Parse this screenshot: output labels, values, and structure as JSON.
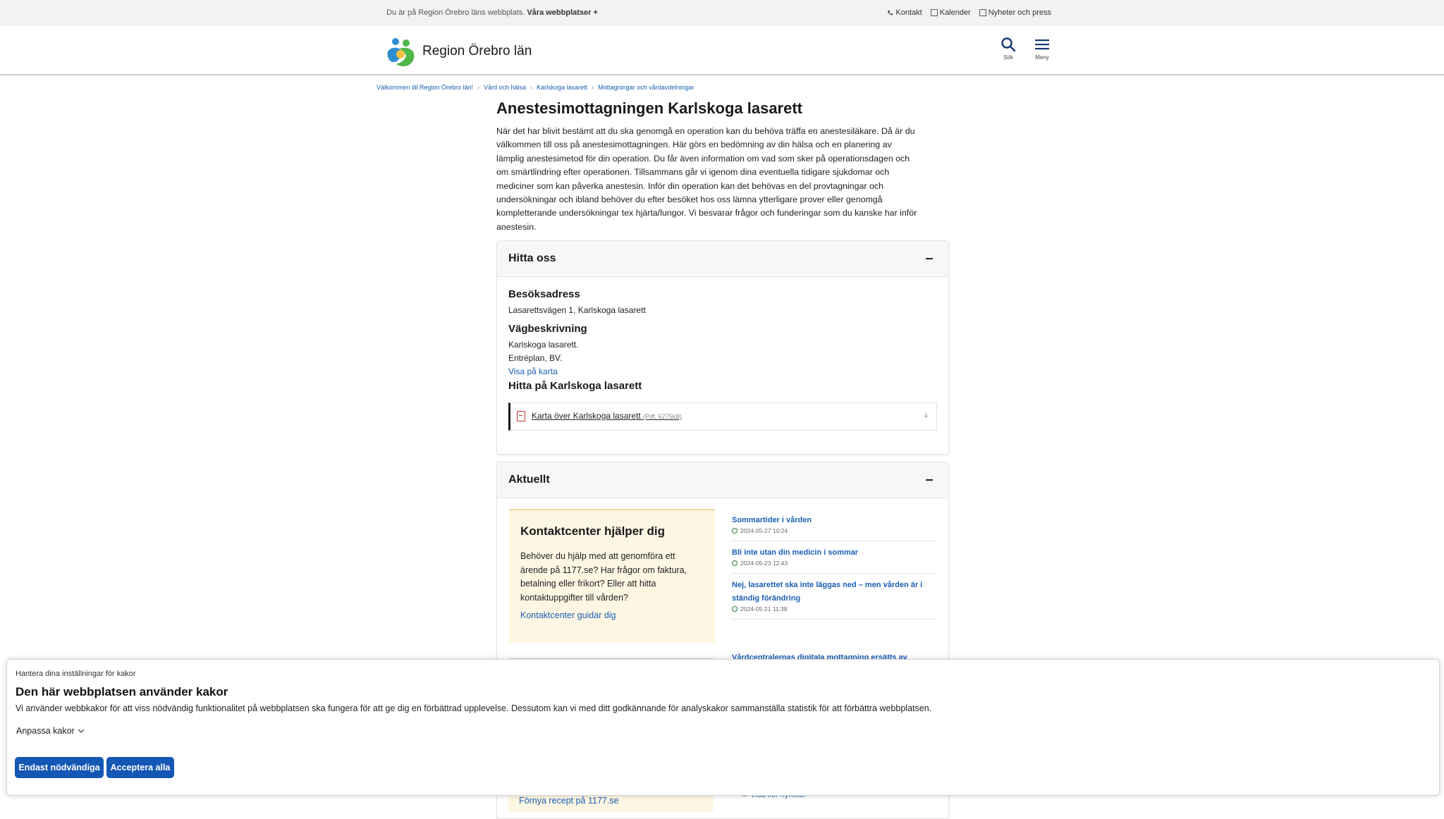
{
  "topbar": {
    "site_note": "Du är på Region Örebro läns webbplats.",
    "sites_link": "Våra webbplatser +",
    "links": [
      "Kontakt",
      "Kalender",
      "Nyheter och press"
    ]
  },
  "header": {
    "brand": "Region Örebro län",
    "search_label": "Sök",
    "menu_label": "Meny"
  },
  "breadcrumb": [
    "Välkommen till Region Örebro län!",
    "Vård och hälsa",
    "Karlskoga lasarett",
    "Mottagningar och vårdavdelningar"
  ],
  "page": {
    "title": "Anestesimottagningen Karlskoga lasarett",
    "intro_lines": [
      "När det har blivit bestämt att du ska genomgå en operation kan du behöva träffa en anestesiläkare. Då är du",
      "välkommen till oss på anestesimottagningen. Här görs en bedömning av din hälsa och en planering av",
      "lämplig anestesimetod för din operation. Du får även information om vad som sker på operationsdagen och",
      "om smärtlindring efter operationen. Tillsammans går vi igenom dina eventuella tidigare sjukdomar och",
      "mediciner som kan påverka anestesin. Inför din operation kan det behövas en del provtagningar och",
      "undersökningar och ibland behöver du efter besöket hos oss lämna ytterligare prover eller genomgå",
      "kompletterande undersökningar tex hjärta/lungor. Vi besvarar frågor och funderingar som du kanske har inför",
      "anestesin."
    ]
  },
  "find_us": {
    "heading": "Hitta oss",
    "visit_heading": "Besöksadress",
    "visit_address": "Lasarettsvägen 1, Karlskoga lasarett",
    "directions_heading": "Vägbeskrivning",
    "directions_line1": "Karlskoga lasarett.",
    "directions_line2": "Entréplan, BV.",
    "map_link": "Visa på karta",
    "find_heading": "Hitta på Karlskoga lasarett",
    "doc_label": "Karta över Karlskoga lasarett",
    "doc_meta": "(Pdf, 6275kB)"
  },
  "news_section": {
    "heading": "Aktuellt",
    "kc_title": "Kontaktcenter hjälper dig",
    "kc_text": "Behöver du hjälp med att genomföra ett ärende på 1177.se? Har frågor om faktura, betalning eller frikort? Eller att hitta kontaktuppgifter till vården?",
    "kc_link": "Kontaktcenter guidar dig",
    "items": [
      {
        "title": "Sommartider i vården",
        "date": "2024-05-27 10:24"
      },
      {
        "title": "Bli inte utan din medicin i sommar",
        "date": "2024-05-23 12:43"
      },
      {
        "title": "Nej, lasarettet ska inte läggas ned – men vården är i ständig förändring",
        "date": "2024-05-21 11:38"
      }
    ],
    "partial_item": "Vårdcentralernas digitala mottagning ersätts av",
    "more_link": "Visa fler nyheter",
    "renew_link": "Förnya recept på 1177.se"
  },
  "cookie": {
    "small": "Hantera dina inställningar för kakor",
    "title": "Den här webbplatsen använder kakor",
    "desc": "Vi använder webbkakor för att viss nödvändig funktionalitet på webbplatsen ska fungera för att ge dig en förbättrad upplevelse. Dessutom kan vi med ditt godkännande för analyskakor sammanställa statistik för att förbättra webbplatsen.",
    "adjust": "Anpassa kakor",
    "btn_necessary": "Endast nödvändiga",
    "btn_accept": "Acceptera alla"
  },
  "colors": {
    "link": "#1a5fb4",
    "button": "#1457b5",
    "highlight_bg": "#fdf6e3",
    "date_icon": "#2e7d32"
  }
}
